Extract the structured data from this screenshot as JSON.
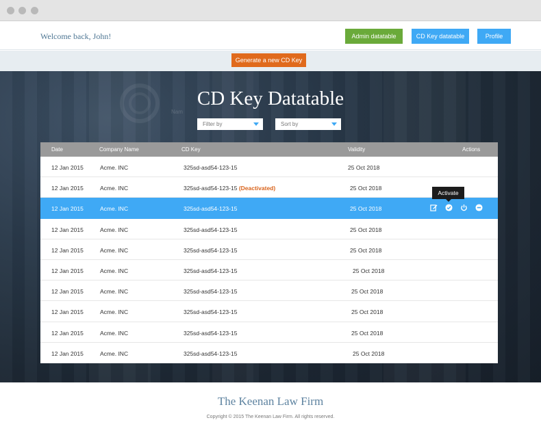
{
  "header": {
    "welcome": "Welcome back, John!",
    "admin_label": "Admin datatable",
    "cdkey_label": "CD Key datatable",
    "profile_label": "Profile"
  },
  "toolbar": {
    "generate_label": "Generate a new CD Key"
  },
  "hero": {
    "title": "CD Key Datatable",
    "ghost_label": "Nam",
    "filter_placeholder": "Filter by",
    "sort_placeholder": "Sort by"
  },
  "table": {
    "columns": [
      "Date",
      "Company Name",
      "CD Key",
      "Validity",
      "Actions"
    ],
    "rows": [
      {
        "date": "12 Jan 2015",
        "company": "Acme. INC",
        "key": "325sd-asd54-123-15",
        "status": "",
        "validity": "25 Oct 2018"
      },
      {
        "date": "12 Jan 2015",
        "company": "Acme. INC",
        "key": "325sd-asd54-123-15",
        "status": "(Deactivated)",
        "validity": "25 Oct 2018"
      },
      {
        "date": "12 Jan 2015",
        "company": "Acme. INC",
        "key": "325sd-asd54-123-15",
        "status": "",
        "validity": "25 Oct 2018"
      },
      {
        "date": "12 Jan 2015",
        "company": "Acme. INC",
        "key": "325sd-asd54-123-15",
        "status": "",
        "validity": "25 Oct 2018"
      },
      {
        "date": "12 Jan 2015",
        "company": "Acme. INC",
        "key": "325sd-asd54-123-15",
        "status": "",
        "validity": "25 Oct 2018"
      },
      {
        "date": "12 Jan 2015",
        "company": "Acme. INC",
        "key": "325sd-asd54-123-15",
        "status": "",
        "validity": "25 Oct 2018"
      },
      {
        "date": "12 Jan 2015",
        "company": "Acme. INC",
        "key": "325sd-asd54-123-15",
        "status": "",
        "validity": "25 Oct 2018"
      },
      {
        "date": "12 Jan 2015",
        "company": "Acme. INC",
        "key": "325sd-asd54-123-15",
        "status": "",
        "validity": "25 Oct 2018"
      },
      {
        "date": "12 Jan 2015",
        "company": "Acme. INC",
        "key": "325sd-asd54-123-15",
        "status": "",
        "validity": "25 Oct 2018"
      },
      {
        "date": "12 Jan 2015",
        "company": "Acme. INC",
        "key": "325sd-asd54-123-15",
        "status": "",
        "validity": "25 Oct 2018"
      }
    ],
    "action_icons": [
      "edit-icon",
      "check-circle-icon",
      "power-icon",
      "minus-circle-icon"
    ]
  },
  "tooltip": {
    "label": "Activate"
  },
  "footer": {
    "brand": "The Keenan Law Firm",
    "copyright": "Copyright © 2015 The Keenan Law Firm. All rights reserved."
  },
  "colors": {
    "accent": "#3fa9f5",
    "admin_green": "#6aaa3a",
    "generate_orange": "#e06a1c",
    "deactivated": "#d9641c"
  }
}
